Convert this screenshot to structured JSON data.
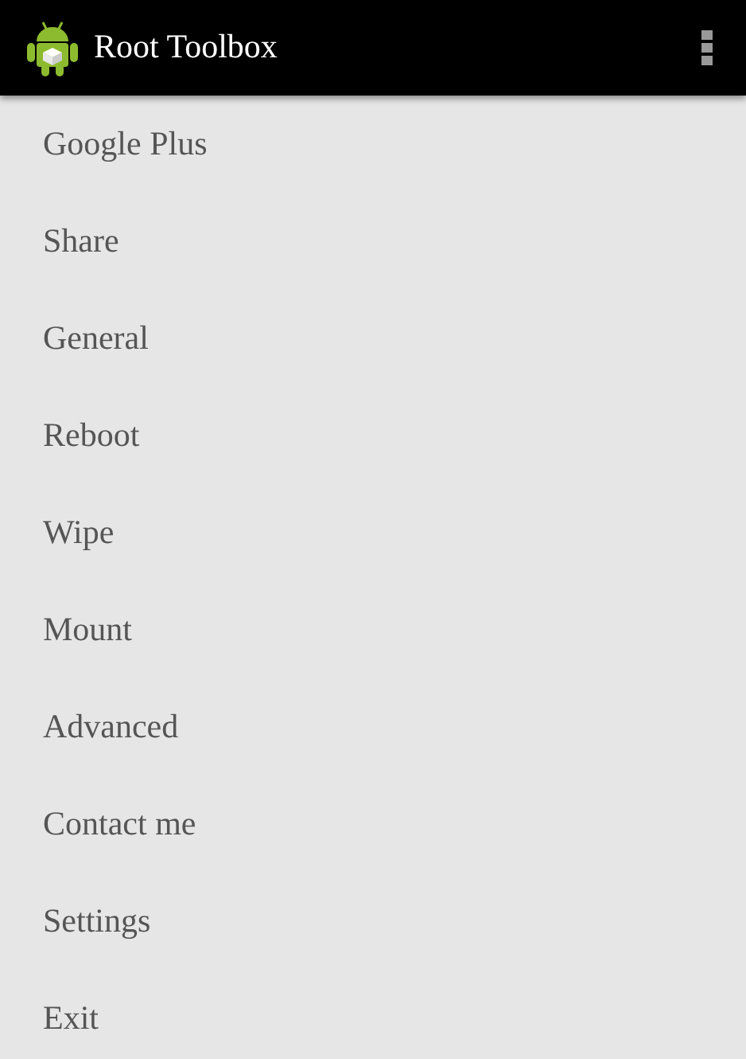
{
  "app_bar": {
    "title": "Root Toolbox"
  },
  "menu_items": [
    {
      "label": "Google Plus"
    },
    {
      "label": "Share"
    },
    {
      "label": "General"
    },
    {
      "label": "Reboot"
    },
    {
      "label": "Wipe"
    },
    {
      "label": "Mount"
    },
    {
      "label": "Advanced"
    },
    {
      "label": "Contact me"
    },
    {
      "label": "Settings"
    },
    {
      "label": "Exit"
    }
  ]
}
